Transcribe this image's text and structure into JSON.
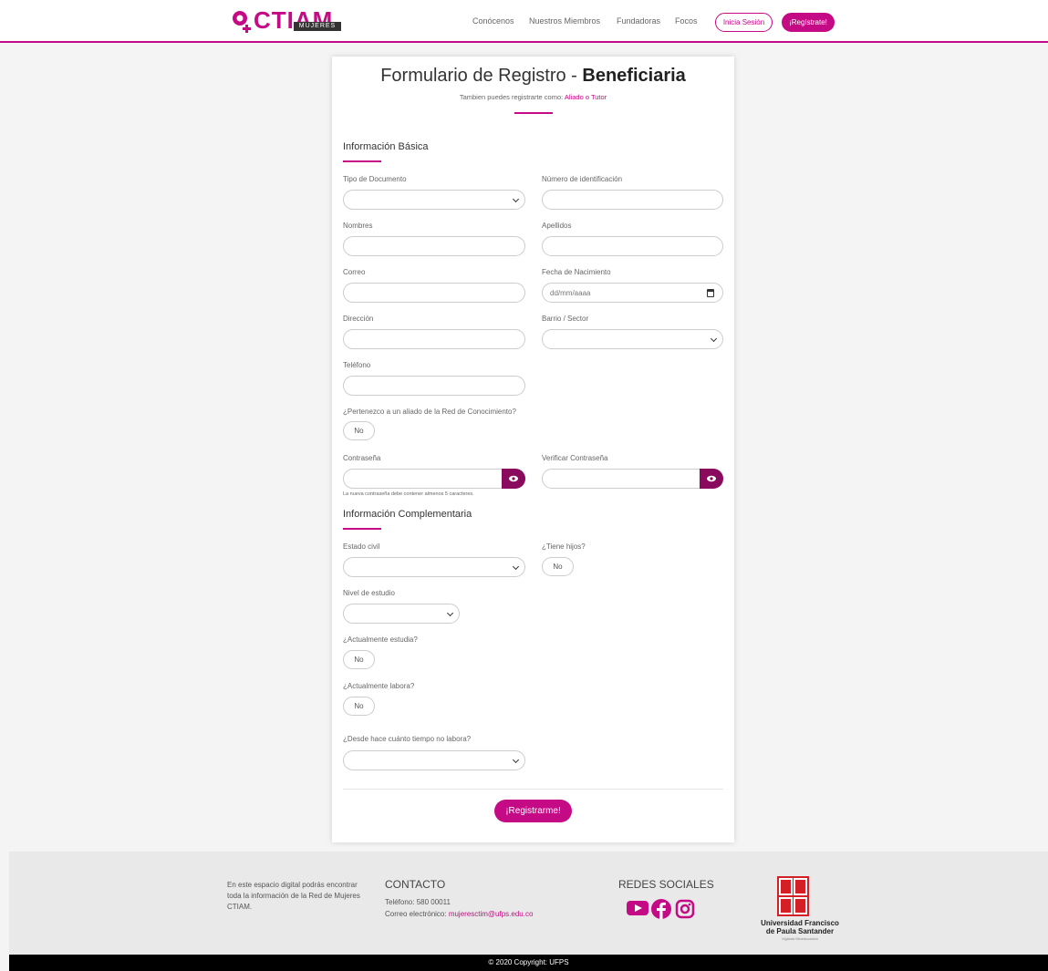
{
  "header": {
    "logo_text": "CTIAM",
    "logo_sub": "MUJERES",
    "nav": [
      "Conócenos",
      "Nuestros Miembros",
      "Fundadoras",
      "Focos"
    ],
    "login": "Inicia Sesión",
    "register": "¡Regístrate!"
  },
  "form": {
    "title": "Formulario de Registro - ",
    "title_bold": "Beneficiaria",
    "subtitle_prefix": "Tambien puedes registrarte como: ",
    "subtitle_links": "Aliado o Tutor",
    "section_basic": "Información Básica",
    "section_complement": "Información Complementaria",
    "labels": {
      "tipo_documento": "Tipo de Documento",
      "numero_id": "Número de identificación",
      "nombres": "Nombres",
      "apellidos": "Apellidos",
      "correo": "Correo",
      "fecha": "Fecha de Nacimiento",
      "direccion": "Dirección",
      "barrio": "Barrio / Sector",
      "telefono": "Teléfono",
      "aliado": "¿Pertenezco a un aliado de la Red de Conocimiento?",
      "contrasena": "Contraseña",
      "verificar": "Verificar Contraseña",
      "estado_civil": "Estado civil",
      "hijos": "¿Tiene hijos?",
      "nivel": "Nivel de estudio",
      "estudia": "¿Actualmente estudia?",
      "labora": "¿Actualmente labora?",
      "desde": "¿Desde hace cuánto tiempo no labora?"
    },
    "date_placeholder": "dd/mm/aaaa",
    "toggle_no": "No",
    "password_hint": "La nueva contraseña debe contener almenos 5 caracteres.",
    "submit": "¡Registrarme!"
  },
  "footer": {
    "about": "En este espacio digital podrás encontrar toda la información de la Red de Mujeres CTIAM.",
    "contact_title": "CONTACTO",
    "phone": "Teléfono: 580 00011",
    "email_label": "Correo electrónico: ",
    "email": "mujeresctim@ufps.edu.co",
    "social_title": "REDES SOCIALES",
    "ufps_mark": "UFPS",
    "ufps_name_1": "Universidad Francisco",
    "ufps_name_2": "de Paula Santander",
    "ufps_tag": "Vigilada Mineducación",
    "copyright": "© 2020 Copyright: UFPS"
  },
  "colors": {
    "accent": "#c40a84",
    "accent_dark": "#8a0a5e",
    "ufps_red": "#d41f26"
  }
}
